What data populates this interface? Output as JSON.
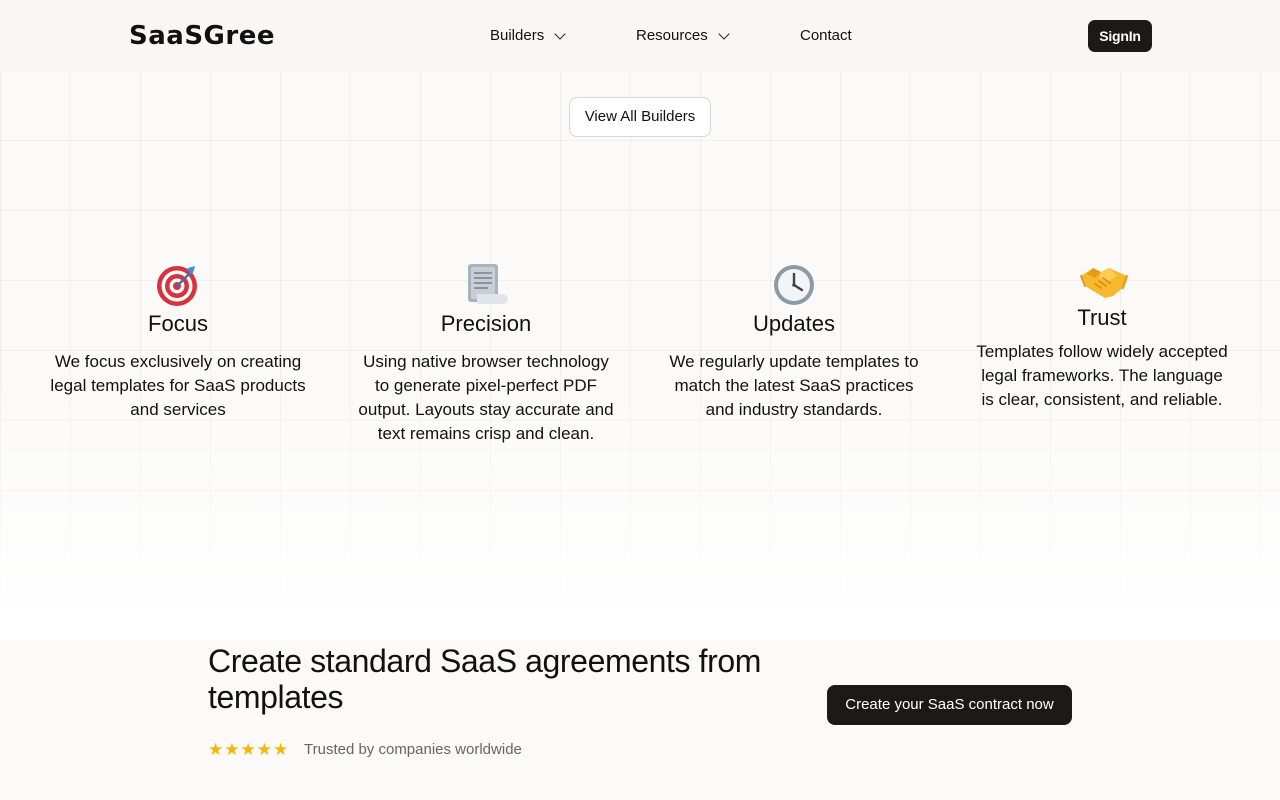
{
  "header": {
    "logo": "SaaSGree",
    "nav": [
      {
        "label": "Builders",
        "has_dropdown": true
      },
      {
        "label": "Resources",
        "has_dropdown": true
      },
      {
        "label": "Contact",
        "has_dropdown": false
      }
    ],
    "signin_label": "SignIn"
  },
  "builders": {
    "view_all_label": "View All Builders"
  },
  "features": [
    {
      "icon": "target-icon",
      "title": "Focus",
      "description": "We focus exclusively on creating legal templates for SaaS products and services"
    },
    {
      "icon": "document-icon",
      "title": "Precision",
      "description": "Using native browser technology to generate pixel-perfect PDF output. Layouts stay accurate and text remains crisp and clean."
    },
    {
      "icon": "clock-icon",
      "title": "Updates",
      "description": "We regularly update templates to match the latest SaaS practices and industry standards."
    },
    {
      "icon": "handshake-icon",
      "title": "Trust",
      "description": "Templates follow widely accepted legal frameworks. The language is clear, consistent, and reliable."
    }
  ],
  "cta": {
    "title": "Create standard SaaS agreements from templates",
    "rating": 5,
    "trusted_text": "Trusted by companies worldwide",
    "button_label": "Create your SaaS contract now"
  },
  "colors": {
    "accent_dark": "#1c1a19",
    "star": "#f5b800",
    "background": "#fbfaf8"
  }
}
